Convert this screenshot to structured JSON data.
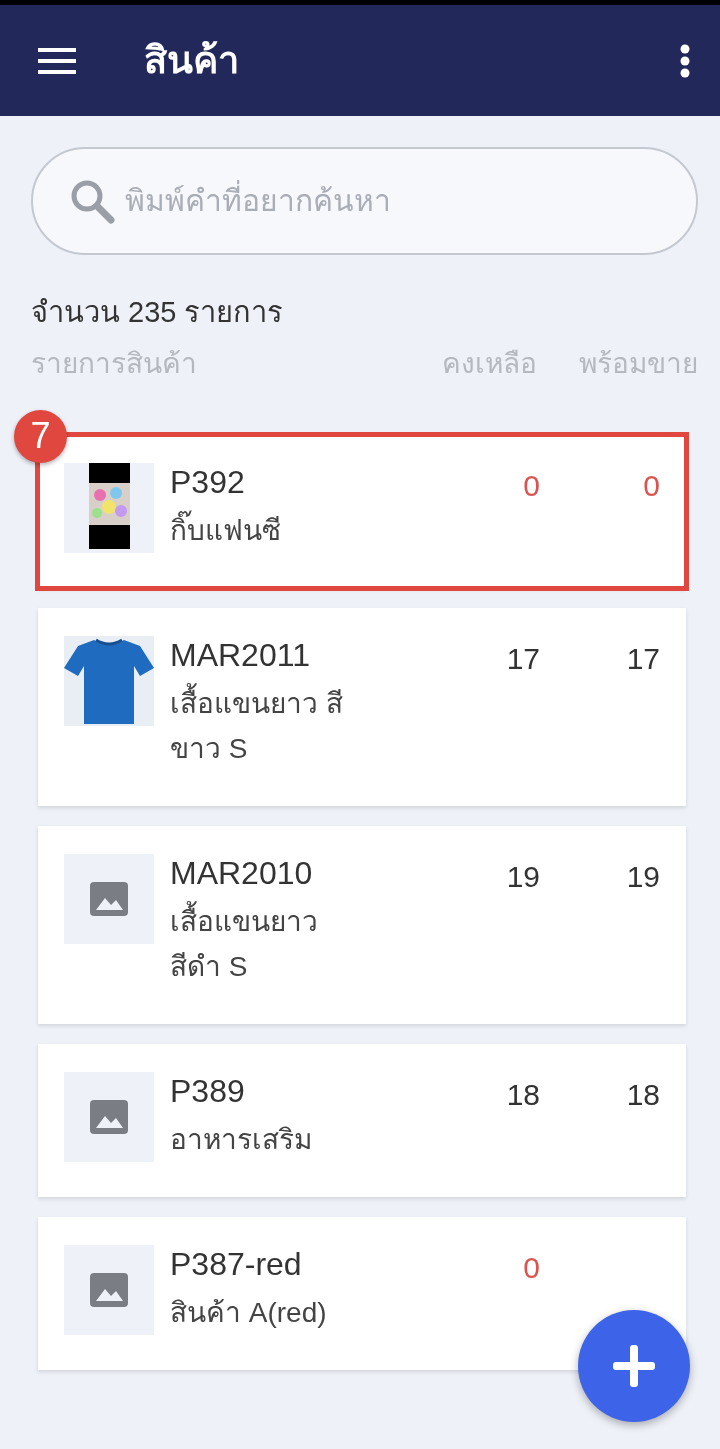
{
  "appbar": {
    "title": "สินค้า"
  },
  "search": {
    "placeholder": "พิมพ์คำที่อยากค้นหา"
  },
  "count": "จำนวน 235 รายการ",
  "columns": [
    "รายการสินค้า",
    "คงเหลือ",
    "พร้อมขาย"
  ],
  "products": [
    {
      "code": "P392",
      "name": "กิ๊บแฟนซี",
      "stock": "0",
      "available": "0",
      "highlighted": true,
      "callout": "7"
    },
    {
      "code": "MAR2011",
      "name": "เสื้อแขนยาว สี ขาว S",
      "stock": "17",
      "available": "17",
      "kind": "shirt",
      "highlighted": false
    },
    {
      "code": "MAR2010",
      "name": "เสื้อแขนยาว สีดำ S",
      "stock": "19",
      "available": "19",
      "kind": "none",
      "highlighted": false
    },
    {
      "code": "P389",
      "name": "อาหารเสริม",
      "stock": "18",
      "available": "18",
      "kind": "none",
      "highlighted": false
    },
    {
      "code": "P387-red",
      "name": "สินค้า A(red)",
      "stock": "0",
      "kind": "none",
      "highlighted": false
    }
  ]
}
